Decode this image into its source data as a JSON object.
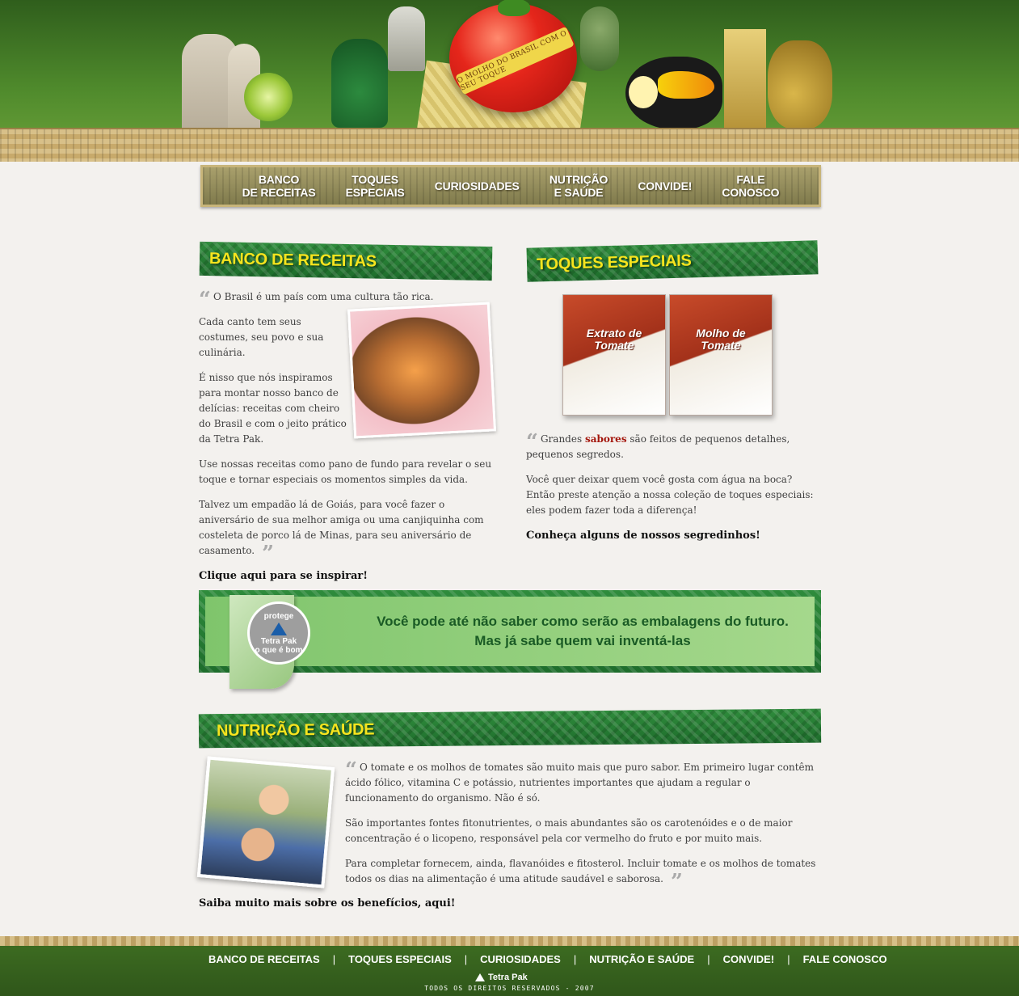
{
  "header": {
    "tomato_band_text": "O MOLHO DO BRASIL COM O SEU TOQUE"
  },
  "nav": {
    "items": [
      {
        "label": "BANCO\nDE RECEITAS"
      },
      {
        "label": "TOQUES\nESPECIAIS"
      },
      {
        "label": "CURIOSIDADES"
      },
      {
        "label": "NUTRIÇÃO\nE SAÚDE"
      },
      {
        "label": "CONVIDE!"
      },
      {
        "label": "FALE\nCONOSCO"
      }
    ]
  },
  "banco": {
    "title": "BANCO DE RECEITAS",
    "p1": "O Brasil é um país com uma cultura tão rica.",
    "p2": "Cada canto tem seus costumes, seu povo e sua culinária.",
    "p3": "É nisso que nós inspiramos para montar nosso banco de delícias: receitas com cheiro do Brasil e com o jeito prático da Tetra Pak.",
    "p4": "Use nossas receitas como pano de fundo para revelar o seu toque e tornar especiais os momentos simples da vida.",
    "p5": "Talvez um empadão lá de Goiás, para você fazer o aniversário de sua melhor amiga ou uma canjiquinha com costeleta de porco lá de Minas, para seu aniversário de casamento.",
    "link": "Clique aqui para se inspirar!"
  },
  "toques": {
    "title": "TOQUES ESPECIAIS",
    "carton1_label": "Extrato de\nTomate",
    "carton2_label": "Molho de\nTomate",
    "p1_pre": "Grandes ",
    "p1_accent": "sabores",
    "p1_post": " são feitos de pequenos detalhes, pequenos segredos.",
    "p2": "Você quer deixar quem você gosta com água na boca? Então preste atenção a nossa coleção de toques especiais: eles podem fazer toda a diferença!",
    "link": "Conheça alguns de nossos segredinhos!"
  },
  "promo": {
    "line1": "Você pode até não saber como serão as embalagens do futuro.",
    "line2": "Mas já sabe quem vai inventá-las",
    "seal_top": "protege",
    "seal_brand": "Tetra Pak",
    "seal_bottom": "o que é bom"
  },
  "nutricao": {
    "title": "NUTRIÇÃO E SAÚDE",
    "p1": "O tomate e os molhos de tomates são muito mais que puro sabor. Em primeiro lugar contêm ácido fólico, vitamina C e potássio, nutrientes importantes que ajudam a regular o funcionamento do organismo. Não é só.",
    "p2": "São importantes fontes fitonutrientes, o mais abundantes são os carotenóides e o de maior concentração é o licopeno, responsável pela cor vermelho do fruto e por muito mais.",
    "p3": "Para completar fornecem, ainda, flavanóides e fitosterol. Incluir tomate e os molhos de tomates todos os dias na alimentação é uma atitude saudável e saborosa.",
    "link": "Saiba muito mais sobre os benefícios, aqui!"
  },
  "footer": {
    "links": [
      "BANCO DE RECEITAS",
      "TOQUES ESPECIAIS",
      "CURIOSIDADES",
      "NUTRIÇÃO E SAÚDE",
      "CONVIDE!",
      "FALE CONOSCO"
    ],
    "separator": "|",
    "brand": "Tetra Pak",
    "copyright": "TODOS OS DIREITOS RESERVADOS - 2007"
  },
  "colors": {
    "banner_green": "#2f8c3c",
    "banner_text_yellow": "#f7e41e",
    "accent_red": "#a4170d",
    "footer_green": "#3f6f22"
  }
}
